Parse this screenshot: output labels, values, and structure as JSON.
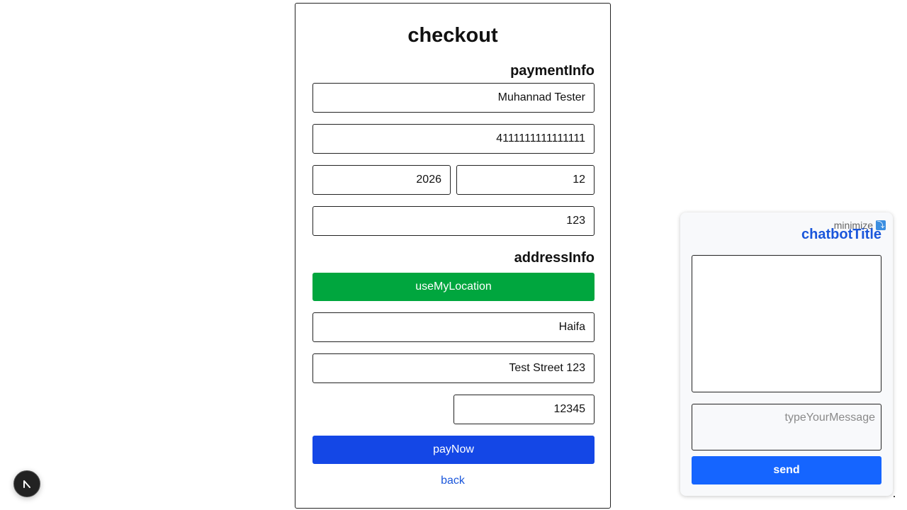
{
  "checkout": {
    "title": "checkout",
    "payment_section_title": "paymentInfo",
    "cardholder_name": "Muhannad Tester",
    "card_number": "4111111111111111",
    "expiry_year": "2026",
    "expiry_month": "12",
    "cvv": "123",
    "address_section_title": "addressInfo",
    "use_location_label": "useMyLocation",
    "city": "Haifa",
    "street": "Test Street 123",
    "zip": "12345",
    "pay_label": "payNow",
    "back_label": "back"
  },
  "chatbot": {
    "minimize_label": "minimize",
    "minimize_icon": "minimize-icon",
    "title": "chatbotTitle",
    "input_placeholder": "typeYourMessage",
    "send_label": "send"
  },
  "colors": {
    "use_location_button": "#00a63e",
    "pay_button": "#1447e6",
    "send_button": "#1565ff",
    "chatbot_title": "#1a56db"
  }
}
